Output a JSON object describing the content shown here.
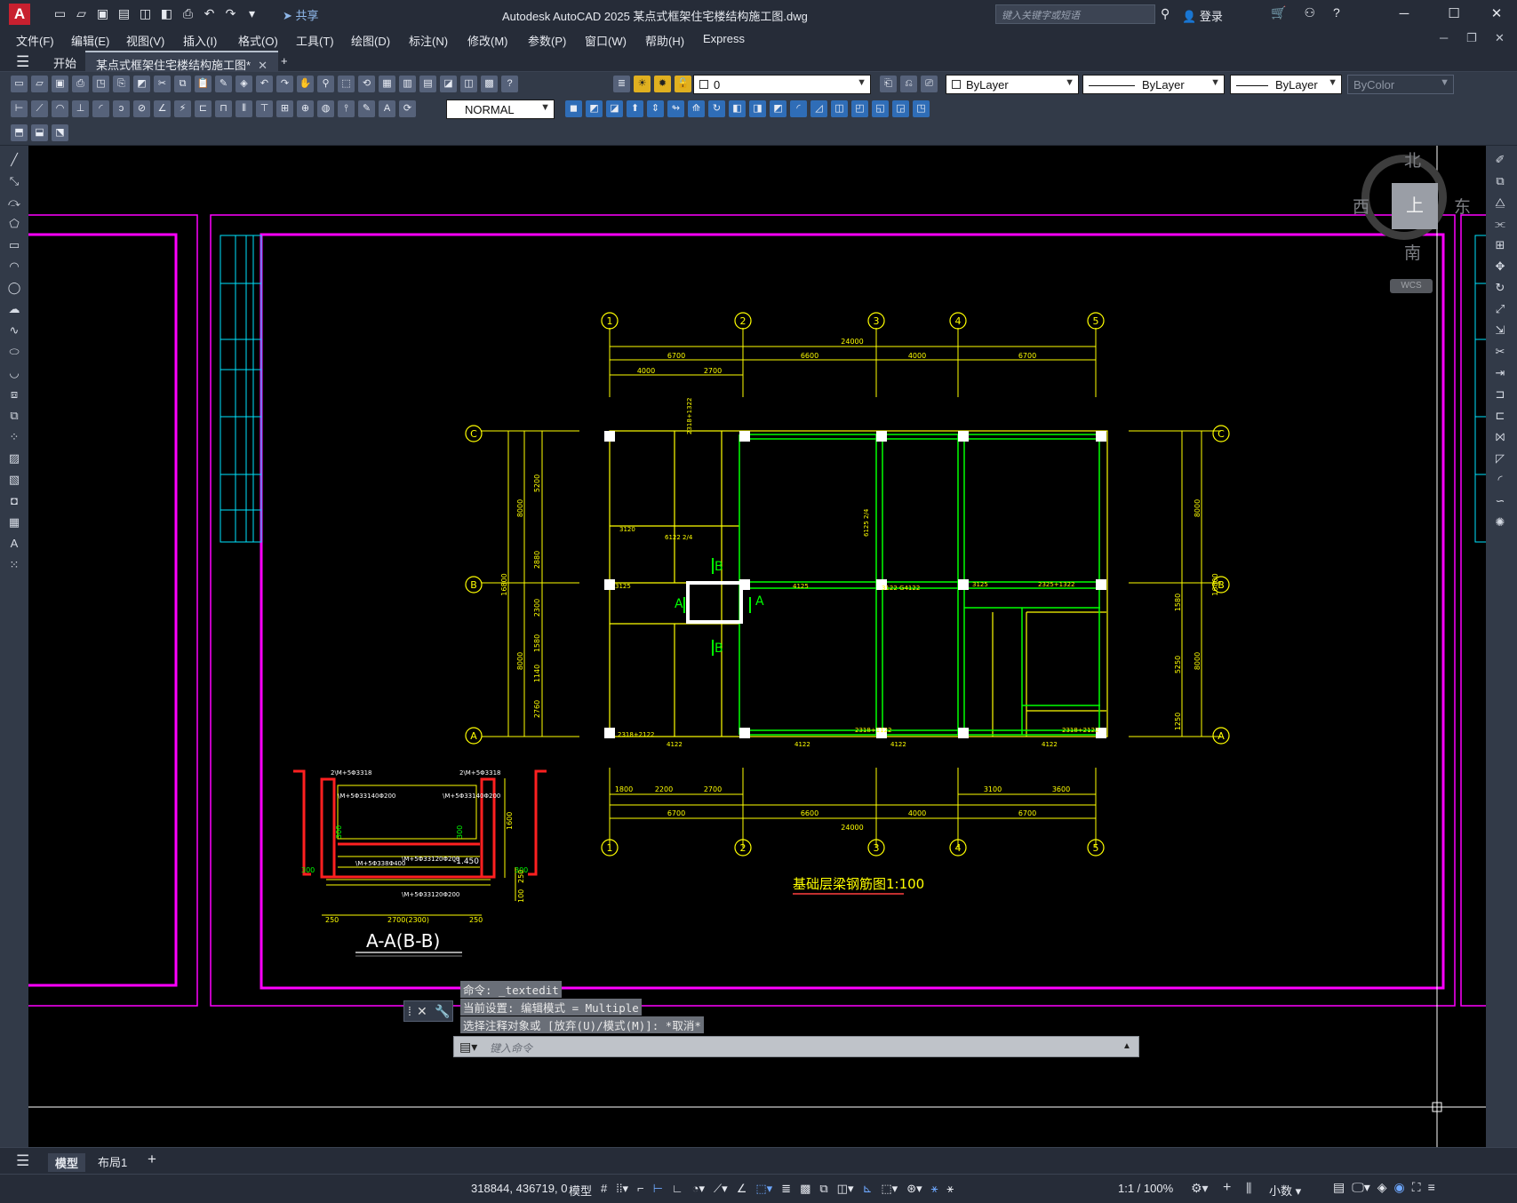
{
  "titlebar": {
    "app_letter": "A",
    "share_label": "共享",
    "title": "Autodesk AutoCAD 2025    某点式框架住宅楼结构施工图.dwg",
    "search_placeholder": "键入关键字或短语",
    "login_label": "登录",
    "min": "─",
    "max": "☐",
    "close": "✕"
  },
  "menubar": {
    "items": [
      "文件(F)",
      "编辑(E)",
      "视图(V)",
      "插入(I)",
      "格式(O)",
      "工具(T)",
      "绘图(D)",
      "标注(N)",
      "修改(M)",
      "参数(P)",
      "窗口(W)",
      "帮助(H)",
      "Express"
    ]
  },
  "tabs": {
    "start": "开始",
    "document": "某点式框架住宅楼结构施工图*",
    "add": "+"
  },
  "toolbar": {
    "layer_name": "0",
    "color": "ByLayer",
    "linetype": "ByLayer",
    "lineweight": "ByLayer",
    "plotstyle": "ByColor",
    "dimstyle": "NORMAL"
  },
  "drawing": {
    "grid_numbers": [
      "1",
      "2",
      "3",
      "4",
      "5"
    ],
    "grid_letters": [
      "C",
      "B",
      "A"
    ],
    "dims_top_total": "24000",
    "dims_top": [
      "6700",
      "6600",
      "4000",
      "6700"
    ],
    "dims_top_sub": [
      "4000",
      "2700"
    ],
    "dims_bottom": [
      "6700",
      "6600",
      "4000",
      "6700"
    ],
    "dims_bottom_sub": [
      "1800",
      "2200",
      "2700",
      "3100",
      "3600"
    ],
    "dims_bottom_total": "24000",
    "dims_left": [
      "5200",
      "2880",
      "2300",
      "1580",
      "1140",
      "2760"
    ],
    "dims_left_total": [
      "8000",
      "16800",
      "8000"
    ],
    "dims_right": [
      "1580",
      "5250",
      "1250"
    ],
    "dims_right_total": [
      "8000",
      "16800",
      "8000"
    ],
    "plan_title": "基础层梁钢筋图1:100",
    "section_title": "A-A(B-B)",
    "section_labels": [
      "2\\M+5Φ3318",
      "2\\M+5Φ3318",
      "\\M+5Φ33140Φ200",
      "\\M+5Φ33140Φ200",
      "\\M+5Φ33120Φ200",
      "\\M+5Φ338Φ400",
      "\\M+5Φ33120Φ200",
      "-1.450",
      "300",
      "300",
      "300",
      "300",
      "1600",
      "250",
      "100"
    ],
    "section_dims": [
      "250",
      "2700(2300)",
      "250"
    ],
    "beam_labels": [
      "2318+1322",
      "3120",
      "3125",
      "4125",
      "6122 2/4",
      "6125 2/4",
      "2318+2122",
      "3122 G4122",
      "2318+1122",
      "2325+1322",
      "3125",
      "2318+2122",
      "4122",
      "4122",
      "4122",
      "4122"
    ],
    "section_marks": [
      "A",
      "A",
      "B",
      "B"
    ]
  },
  "viewcube": {
    "north": "北",
    "south": "南",
    "west": "西",
    "east": "东",
    "top": "上",
    "wcs": "WCS"
  },
  "command": {
    "history": [
      "命令: _textedit",
      "当前设置: 编辑模式 = Multiple",
      "选择注释对象或 [放弃(U)/模式(M)]: *取消*"
    ],
    "placeholder": "键入命令"
  },
  "layout_tabs": {
    "model": "模型",
    "layout1": "布局1",
    "add": "+"
  },
  "status": {
    "coords": "318844, 436719, 0",
    "space": "模型",
    "scale": "1:1 / 100%",
    "units": "小数"
  }
}
